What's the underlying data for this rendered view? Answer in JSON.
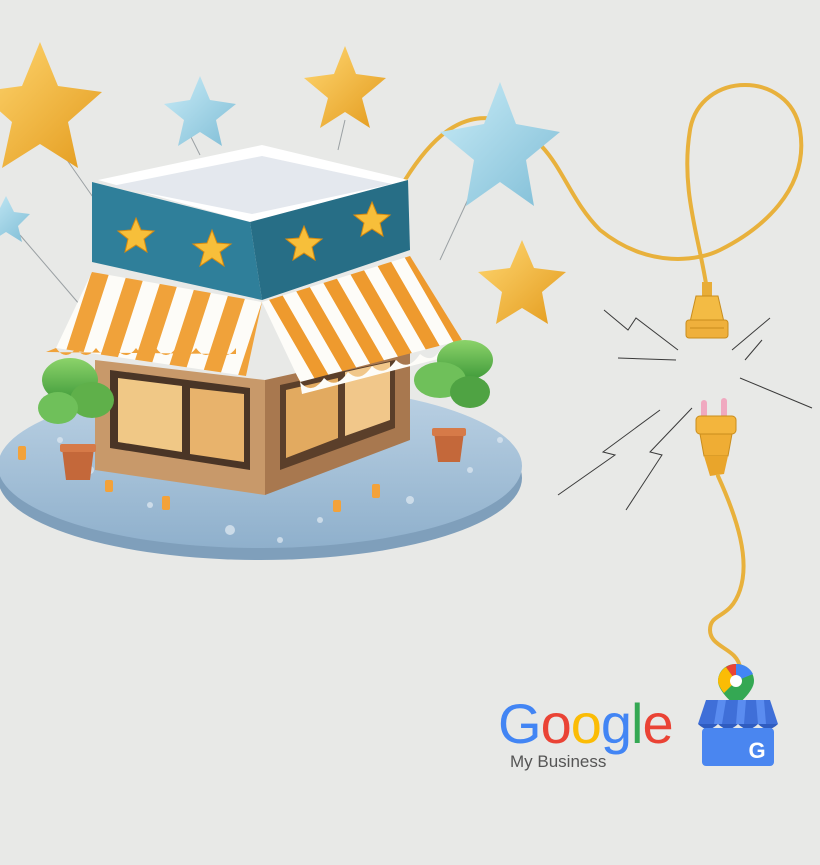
{
  "brand": {
    "letters": [
      "G",
      "o",
      "o",
      "g",
      "l",
      "e"
    ],
    "letter_colors": [
      "#4285F4",
      "#EA4335",
      "#FBBC05",
      "#4285F4",
      "#34A853",
      "#EA4335"
    ],
    "subtitle": "My Business",
    "icon_letter": "G"
  },
  "illustration": {
    "subject": "storefront-with-star-ratings",
    "icons": [
      "star-icon",
      "power-plug-icon",
      "power-socket-icon",
      "map-pin-icon",
      "store-icon"
    ]
  },
  "colors": {
    "background": "#e8e9e7",
    "awning_orange": "#f0a23a",
    "store_teal": "#2f7f9a",
    "star_gold": "#f2b631",
    "star_blue": "#9fd2e6",
    "cable": "#e8b13c",
    "platform": "#a9c3d8"
  }
}
